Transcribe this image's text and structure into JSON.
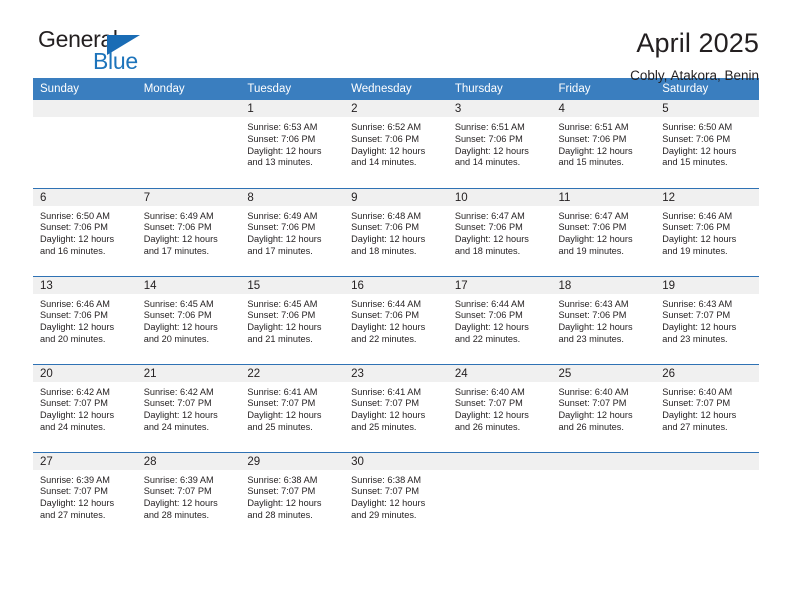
{
  "brand": {
    "name_part1": "General",
    "name_part2": "Blue",
    "triangle_color": "#1a6cb5"
  },
  "header": {
    "title": "April 2025",
    "subtitle": "Cobly, Atakora, Benin",
    "header_bg_color": "#3a7ebf",
    "row_divider_color": "#2f72b4",
    "daynum_bg_color": "#f0f0f0"
  },
  "weekdays": [
    "Sunday",
    "Monday",
    "Tuesday",
    "Wednesday",
    "Thursday",
    "Friday",
    "Saturday"
  ],
  "labels": {
    "sunrise_prefix": "Sunrise:",
    "sunset_prefix": "Sunset:",
    "daylight_prefix": "Daylight:"
  },
  "weeks": [
    [
      {
        "day": "",
        "sunrise": "",
        "sunset": "",
        "daylight_line1": "",
        "daylight_line2": ""
      },
      {
        "day": "",
        "sunrise": "",
        "sunset": "",
        "daylight_line1": "",
        "daylight_line2": ""
      },
      {
        "day": "1",
        "sunrise": "Sunrise: 6:53 AM",
        "sunset": "Sunset: 7:06 PM",
        "daylight_line1": "Daylight: 12 hours",
        "daylight_line2": "and 13 minutes."
      },
      {
        "day": "2",
        "sunrise": "Sunrise: 6:52 AM",
        "sunset": "Sunset: 7:06 PM",
        "daylight_line1": "Daylight: 12 hours",
        "daylight_line2": "and 14 minutes."
      },
      {
        "day": "3",
        "sunrise": "Sunrise: 6:51 AM",
        "sunset": "Sunset: 7:06 PM",
        "daylight_line1": "Daylight: 12 hours",
        "daylight_line2": "and 14 minutes."
      },
      {
        "day": "4",
        "sunrise": "Sunrise: 6:51 AM",
        "sunset": "Sunset: 7:06 PM",
        "daylight_line1": "Daylight: 12 hours",
        "daylight_line2": "and 15 minutes."
      },
      {
        "day": "5",
        "sunrise": "Sunrise: 6:50 AM",
        "sunset": "Sunset: 7:06 PM",
        "daylight_line1": "Daylight: 12 hours",
        "daylight_line2": "and 15 minutes."
      }
    ],
    [
      {
        "day": "6",
        "sunrise": "Sunrise: 6:50 AM",
        "sunset": "Sunset: 7:06 PM",
        "daylight_line1": "Daylight: 12 hours",
        "daylight_line2": "and 16 minutes."
      },
      {
        "day": "7",
        "sunrise": "Sunrise: 6:49 AM",
        "sunset": "Sunset: 7:06 PM",
        "daylight_line1": "Daylight: 12 hours",
        "daylight_line2": "and 17 minutes."
      },
      {
        "day": "8",
        "sunrise": "Sunrise: 6:49 AM",
        "sunset": "Sunset: 7:06 PM",
        "daylight_line1": "Daylight: 12 hours",
        "daylight_line2": "and 17 minutes."
      },
      {
        "day": "9",
        "sunrise": "Sunrise: 6:48 AM",
        "sunset": "Sunset: 7:06 PM",
        "daylight_line1": "Daylight: 12 hours",
        "daylight_line2": "and 18 minutes."
      },
      {
        "day": "10",
        "sunrise": "Sunrise: 6:47 AM",
        "sunset": "Sunset: 7:06 PM",
        "daylight_line1": "Daylight: 12 hours",
        "daylight_line2": "and 18 minutes."
      },
      {
        "day": "11",
        "sunrise": "Sunrise: 6:47 AM",
        "sunset": "Sunset: 7:06 PM",
        "daylight_line1": "Daylight: 12 hours",
        "daylight_line2": "and 19 minutes."
      },
      {
        "day": "12",
        "sunrise": "Sunrise: 6:46 AM",
        "sunset": "Sunset: 7:06 PM",
        "daylight_line1": "Daylight: 12 hours",
        "daylight_line2": "and 19 minutes."
      }
    ],
    [
      {
        "day": "13",
        "sunrise": "Sunrise: 6:46 AM",
        "sunset": "Sunset: 7:06 PM",
        "daylight_line1": "Daylight: 12 hours",
        "daylight_line2": "and 20 minutes."
      },
      {
        "day": "14",
        "sunrise": "Sunrise: 6:45 AM",
        "sunset": "Sunset: 7:06 PM",
        "daylight_line1": "Daylight: 12 hours",
        "daylight_line2": "and 20 minutes."
      },
      {
        "day": "15",
        "sunrise": "Sunrise: 6:45 AM",
        "sunset": "Sunset: 7:06 PM",
        "daylight_line1": "Daylight: 12 hours",
        "daylight_line2": "and 21 minutes."
      },
      {
        "day": "16",
        "sunrise": "Sunrise: 6:44 AM",
        "sunset": "Sunset: 7:06 PM",
        "daylight_line1": "Daylight: 12 hours",
        "daylight_line2": "and 22 minutes."
      },
      {
        "day": "17",
        "sunrise": "Sunrise: 6:44 AM",
        "sunset": "Sunset: 7:06 PM",
        "daylight_line1": "Daylight: 12 hours",
        "daylight_line2": "and 22 minutes."
      },
      {
        "day": "18",
        "sunrise": "Sunrise: 6:43 AM",
        "sunset": "Sunset: 7:06 PM",
        "daylight_line1": "Daylight: 12 hours",
        "daylight_line2": "and 23 minutes."
      },
      {
        "day": "19",
        "sunrise": "Sunrise: 6:43 AM",
        "sunset": "Sunset: 7:07 PM",
        "daylight_line1": "Daylight: 12 hours",
        "daylight_line2": "and 23 minutes."
      }
    ],
    [
      {
        "day": "20",
        "sunrise": "Sunrise: 6:42 AM",
        "sunset": "Sunset: 7:07 PM",
        "daylight_line1": "Daylight: 12 hours",
        "daylight_line2": "and 24 minutes."
      },
      {
        "day": "21",
        "sunrise": "Sunrise: 6:42 AM",
        "sunset": "Sunset: 7:07 PM",
        "daylight_line1": "Daylight: 12 hours",
        "daylight_line2": "and 24 minutes."
      },
      {
        "day": "22",
        "sunrise": "Sunrise: 6:41 AM",
        "sunset": "Sunset: 7:07 PM",
        "daylight_line1": "Daylight: 12 hours",
        "daylight_line2": "and 25 minutes."
      },
      {
        "day": "23",
        "sunrise": "Sunrise: 6:41 AM",
        "sunset": "Sunset: 7:07 PM",
        "daylight_line1": "Daylight: 12 hours",
        "daylight_line2": "and 25 minutes."
      },
      {
        "day": "24",
        "sunrise": "Sunrise: 6:40 AM",
        "sunset": "Sunset: 7:07 PM",
        "daylight_line1": "Daylight: 12 hours",
        "daylight_line2": "and 26 minutes."
      },
      {
        "day": "25",
        "sunrise": "Sunrise: 6:40 AM",
        "sunset": "Sunset: 7:07 PM",
        "daylight_line1": "Daylight: 12 hours",
        "daylight_line2": "and 26 minutes."
      },
      {
        "day": "26",
        "sunrise": "Sunrise: 6:40 AM",
        "sunset": "Sunset: 7:07 PM",
        "daylight_line1": "Daylight: 12 hours",
        "daylight_line2": "and 27 minutes."
      }
    ],
    [
      {
        "day": "27",
        "sunrise": "Sunrise: 6:39 AM",
        "sunset": "Sunset: 7:07 PM",
        "daylight_line1": "Daylight: 12 hours",
        "daylight_line2": "and 27 minutes."
      },
      {
        "day": "28",
        "sunrise": "Sunrise: 6:39 AM",
        "sunset": "Sunset: 7:07 PM",
        "daylight_line1": "Daylight: 12 hours",
        "daylight_line2": "and 28 minutes."
      },
      {
        "day": "29",
        "sunrise": "Sunrise: 6:38 AM",
        "sunset": "Sunset: 7:07 PM",
        "daylight_line1": "Daylight: 12 hours",
        "daylight_line2": "and 28 minutes."
      },
      {
        "day": "30",
        "sunrise": "Sunrise: 6:38 AM",
        "sunset": "Sunset: 7:07 PM",
        "daylight_line1": "Daylight: 12 hours",
        "daylight_line2": "and 29 minutes."
      },
      {
        "day": "",
        "sunrise": "",
        "sunset": "",
        "daylight_line1": "",
        "daylight_line2": ""
      },
      {
        "day": "",
        "sunrise": "",
        "sunset": "",
        "daylight_line1": "",
        "daylight_line2": ""
      },
      {
        "day": "",
        "sunrise": "",
        "sunset": "",
        "daylight_line1": "",
        "daylight_line2": ""
      }
    ]
  ]
}
